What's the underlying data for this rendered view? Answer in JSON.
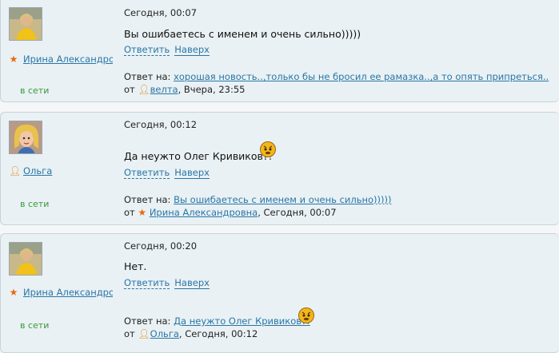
{
  "posts": [
    {
      "author": "Ирина Александровна",
      "status": "в сети",
      "date": "Сегодня, 00:07",
      "text": "Вы ошибаетесь с именем и очень сильно)))))",
      "reply_label": "Ответить",
      "up_label": "Наверх",
      "reply_to_prefix": "Ответ на:",
      "reply_to_text": "хорошая новость..,только бы не бросил ее рамазка..,а то опять припреться..",
      "from_prefix": "от",
      "from_user": "велта",
      "from_rest": ", Вчера, 23:55"
    },
    {
      "author": "Ольга",
      "status": "в сети",
      "date": "Сегодня, 00:12",
      "text": "Да неужто Олег Кривиков?!",
      "reply_label": "Ответить",
      "up_label": "Наверх",
      "reply_to_prefix": "Ответ на:",
      "reply_to_text": "Вы ошибаетесь с именем и очень сильно)))))",
      "from_prefix": "от",
      "from_user": "Ирина Александровна",
      "from_rest": ", Сегодня, 00:07"
    },
    {
      "author": "Ирина Александровна",
      "status": "в сети",
      "date": "Сегодня, 00:20",
      "text": "Нет.",
      "reply_label": "Ответить",
      "up_label": "Наверх",
      "reply_to_prefix": "Ответ на:",
      "reply_to_text": "Да неужто Олег Кривиков?!",
      "from_prefix": "от",
      "from_user": "Ольга",
      "from_rest": ", Сегодня, 00:12"
    }
  ],
  "icons": {
    "star": "star-icon",
    "user": "user-icon",
    "smiley": "smiley-icon",
    "star_color": "#e46a13",
    "user_color": "#e58a17",
    "link_color": "#2a76a8",
    "online_color": "#3a9a3a"
  }
}
